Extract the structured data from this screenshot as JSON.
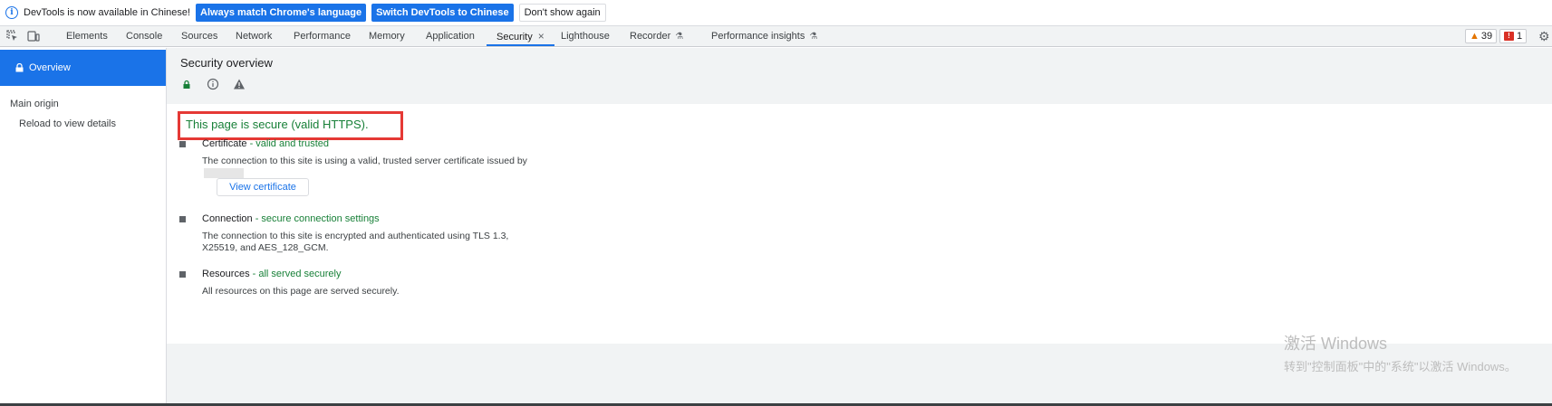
{
  "infobar": {
    "message": "DevTools is now available in Chinese!",
    "btn_match": "Always match Chrome's language",
    "btn_switch": "Switch DevTools to Chinese",
    "btn_dismiss": "Don't show again"
  },
  "tabs": {
    "elements": "Elements",
    "console": "Console",
    "sources": "Sources",
    "network": "Network",
    "performance": "Performance",
    "memory": "Memory",
    "application": "Application",
    "security": "Security",
    "close_glyph": "×",
    "lighthouse": "Lighthouse",
    "recorder": "Recorder",
    "perf_insights": "Performance insights",
    "flask_glyph": "⚗"
  },
  "counters": {
    "warnings": "39",
    "errors": "1",
    "warn_glyph": "▲",
    "err_glyph": "!"
  },
  "sidebar": {
    "overview": "Overview",
    "main_origin": "Main origin",
    "reload": "Reload to view details"
  },
  "main": {
    "title": "Security overview",
    "summary": "This page is secure (valid HTTPS).",
    "certificate": {
      "label": "Certificate",
      "status": " - valid and trusted",
      "desc": "The connection to this site is using a valid, trusted server certificate issued by",
      "button": "View certificate"
    },
    "connection": {
      "label": "Connection",
      "status": " - secure connection settings",
      "desc": "The connection to this site is encrypted and authenticated using TLS 1.3, X25519, and AES_128_GCM."
    },
    "resources": {
      "label": "Resources",
      "status": " - all served securely",
      "desc": "All resources on this page are served securely."
    }
  },
  "watermark": {
    "line1": "激活 Windows",
    "line2": "转到\"控制面板\"中的\"系统\"以激活 Windows。"
  },
  "colors": {
    "accent": "#1a73e8",
    "secure_green": "#188038",
    "highlight_red": "#e53935"
  }
}
